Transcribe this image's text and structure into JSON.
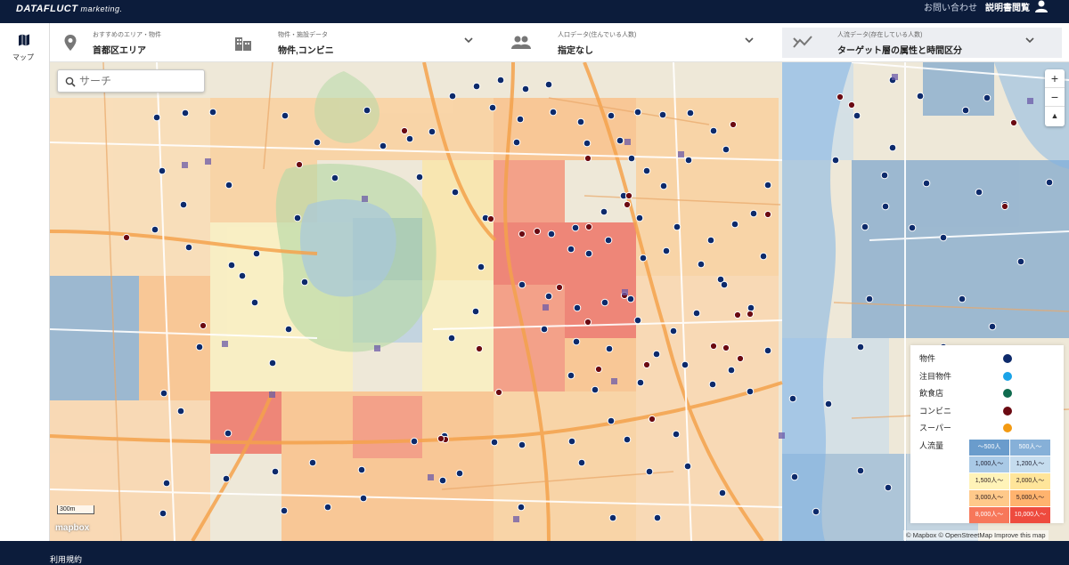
{
  "header": {
    "logo": "DATAFLUCT",
    "logo_sub": "marketing.",
    "contact": "お問い合わせ",
    "manual": "説明書閲覧",
    "user_icon": "user-icon"
  },
  "rail": {
    "map_label": "マップ",
    "map_icon": "map-icon"
  },
  "filters": [
    {
      "label": "おすすめのエリア・物件",
      "value": "首都区エリア",
      "icon": "location-pin-icon"
    },
    {
      "label": "物件・施設データ",
      "value": "物件,コンビニ",
      "icon": "building-icon"
    },
    {
      "label": "人口データ(住んでいる人数)",
      "value": "指定なし",
      "icon": "people-icon"
    },
    {
      "label": "人流データ(存在している人数)",
      "value": "ターゲット層の属性と時間区分",
      "icon": "flow-trend-icon"
    }
  ],
  "map": {
    "search_placeholder": "サーチ",
    "zoom_in": "+",
    "zoom_out": "−",
    "compass": "▲",
    "scale": "300m",
    "mapbox_logo": "mapbox",
    "attribution": "© Mapbox © OpenStreetMap Improve this map"
  },
  "legend": {
    "items": [
      {
        "label": "物件",
        "color": "#0d2a6b"
      },
      {
        "label": "注目物件",
        "color": "#1aa3e8"
      },
      {
        "label": "飲食店",
        "color": "#0f6b4e"
      },
      {
        "label": "コンビニ",
        "color": "#6b0a12"
      },
      {
        "label": "スーパー",
        "color": "#f39a12"
      }
    ],
    "flow_title": "人流量",
    "flow_cells": [
      {
        "label": "〜500人",
        "color": "#6a9ccc"
      },
      {
        "label": "500人〜",
        "color": "#86b0d8"
      },
      {
        "label": "1,000人〜",
        "color": "#a9c9e6"
      },
      {
        "label": "1,200人〜",
        "color": "#c5dcee"
      },
      {
        "label": "1,500人〜",
        "color": "#fff3b8"
      },
      {
        "label": "2,000人〜",
        "color": "#ffe59a"
      },
      {
        "label": "3,000人〜",
        "color": "#ffc98a"
      },
      {
        "label": "5,000人〜",
        "color": "#ffb36e"
      },
      {
        "label": "8,000人〜",
        "color": "#f7775a"
      },
      {
        "label": "10,000人〜",
        "color": "#ee4b3e"
      }
    ]
  },
  "footer": {
    "link": "利用規約"
  }
}
